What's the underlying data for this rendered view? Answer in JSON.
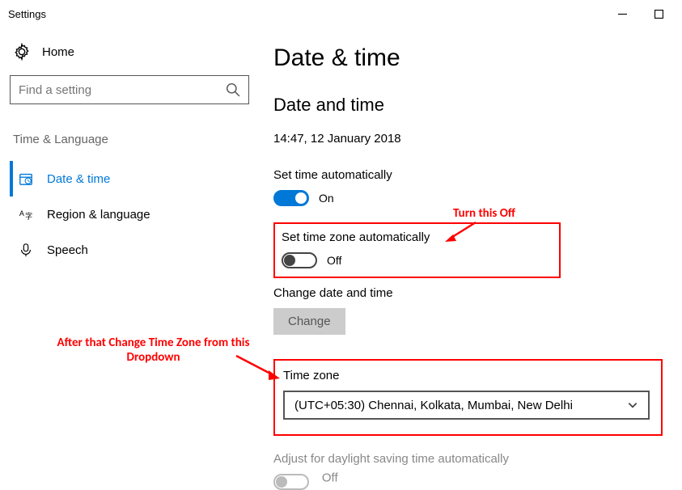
{
  "window": {
    "title": "Settings"
  },
  "sidebar": {
    "home": "Home",
    "searchPlaceholder": "Find a setting",
    "category": "Time & Language",
    "items": [
      {
        "label": "Date & time"
      },
      {
        "label": "Region & language"
      },
      {
        "label": "Speech"
      }
    ]
  },
  "main": {
    "heading": "Date & time",
    "subheading": "Date and time",
    "datetime": "14:47, 12 January 2018",
    "setTimeAuto": {
      "label": "Set time automatically",
      "state": "On"
    },
    "setZoneAuto": {
      "label": "Set time zone automatically",
      "state": "Off"
    },
    "changeLabel": "Change date and time",
    "changeButton": "Change",
    "timeZone": {
      "label": "Time zone",
      "value": "(UTC+05:30) Chennai, Kolkata, Mumbai, New Delhi"
    },
    "daylight": {
      "label": "Adjust for daylight saving time automatically",
      "state": "Off"
    }
  },
  "annotations": {
    "a1": "Turn this Off",
    "a2": "After that Change Time Zone from this Dropdown"
  }
}
